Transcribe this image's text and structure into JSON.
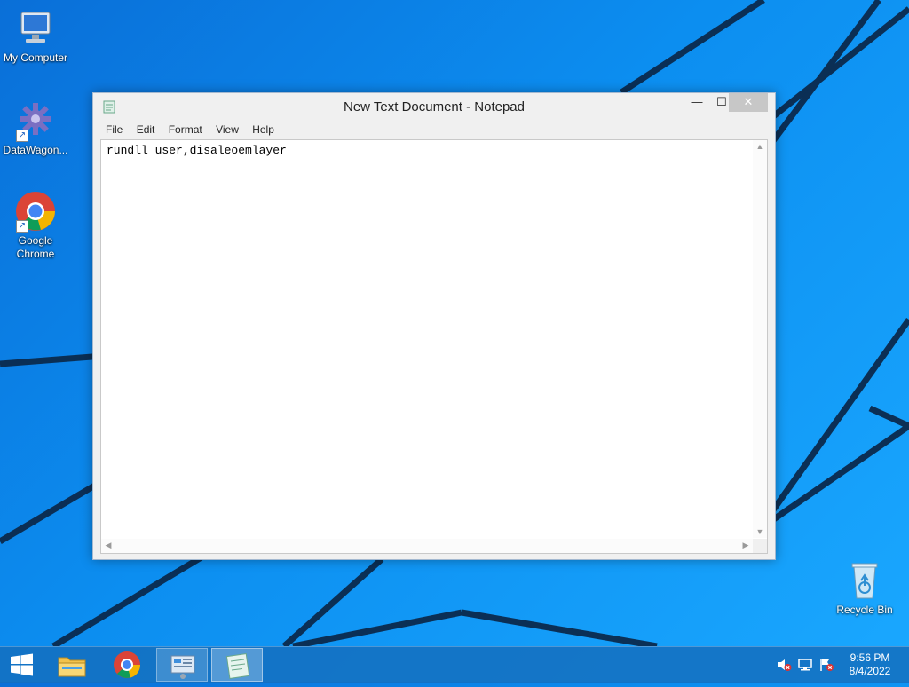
{
  "desktop": {
    "icons": [
      {
        "label": "My Computer",
        "icon": "computer-icon"
      },
      {
        "label": "DataWagon...",
        "icon": "datawagon-icon"
      },
      {
        "label": "Google Chrome",
        "icon": "chrome-icon"
      },
      {
        "label": "Recycle Bin",
        "icon": "recycle-bin-icon"
      }
    ]
  },
  "notepad": {
    "title": "New Text Document - Notepad",
    "controls": {
      "minimize": "—",
      "maximize": "☐",
      "close": "✕"
    },
    "menu": [
      "File",
      "Edit",
      "Format",
      "View",
      "Help"
    ],
    "content": "rundll user,disaleoemlayer"
  },
  "taskbar": {
    "apps": [
      "start-icon",
      "file-explorer-icon",
      "chrome-icon",
      "control-panel-icon",
      "notepad-icon"
    ],
    "active_app": "notepad-icon",
    "tray": [
      "volume-muted-icon",
      "network-icon",
      "action-center-flag-icon"
    ],
    "time": "9:56 PM",
    "date": "8/4/2022"
  },
  "colors": {
    "accent": "#0c8ef0",
    "taskbar": "#146ebe"
  }
}
